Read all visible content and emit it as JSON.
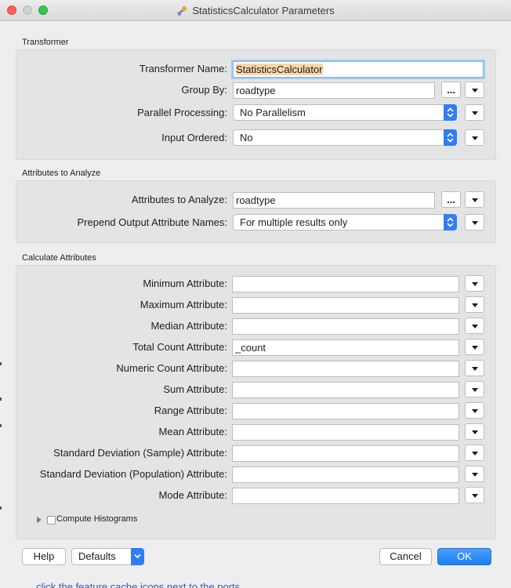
{
  "window": {
    "title": "StatisticsCalculator Parameters"
  },
  "transformer_section": {
    "heading": "Transformer",
    "transformer_name_label": "Transformer Name:",
    "transformer_name_value": "StatisticsCalculator",
    "group_by_label": "Group By:",
    "group_by_value": "roadtype",
    "parallel_label": "Parallel Processing:",
    "parallel_value": "No Parallelism",
    "input_ordered_label": "Input Ordered:",
    "input_ordered_value": "No"
  },
  "attributes_section": {
    "heading": "Attributes to Analyze",
    "attrs_label": "Attributes to Analyze:",
    "attrs_value": "roadtype",
    "prepend_label": "Prepend Output Attribute Names:",
    "prepend_value": "For multiple results only"
  },
  "calculate_section": {
    "heading": "Calculate Attributes",
    "rows": [
      {
        "label": "Minimum Attribute:",
        "value": ""
      },
      {
        "label": "Maximum Attribute:",
        "value": ""
      },
      {
        "label": "Median Attribute:",
        "value": ""
      },
      {
        "label": "Total Count Attribute:",
        "value": "_count"
      },
      {
        "label": "Numeric Count Attribute:",
        "value": ""
      },
      {
        "label": "Sum Attribute:",
        "value": ""
      },
      {
        "label": "Range Attribute:",
        "value": ""
      },
      {
        "label": "Mean Attribute:",
        "value": ""
      },
      {
        "label": "Standard Deviation (Sample) Attribute:",
        "value": ""
      },
      {
        "label": "Standard Deviation (Population) Attribute:",
        "value": ""
      },
      {
        "label": "Mode Attribute:",
        "value": ""
      }
    ],
    "compute_histograms_label": "Compute Histograms",
    "compute_histograms_checked": false
  },
  "footer": {
    "help_label": "Help",
    "defaults_label": "Defaults",
    "cancel_label": "Cancel",
    "ok_label": "OK"
  },
  "background_text": "click the feature cache icons next to the ports",
  "icons": {
    "title_icon": "transformer-icon",
    "browse": "ellipsis-icon",
    "menu": "triangle-down-icon",
    "combo": "up-down-chevron-icon"
  },
  "colors": {
    "accent": "#2f7ef5",
    "selection": "#f9d7a9",
    "focus_ring": "#a8c9f0"
  }
}
